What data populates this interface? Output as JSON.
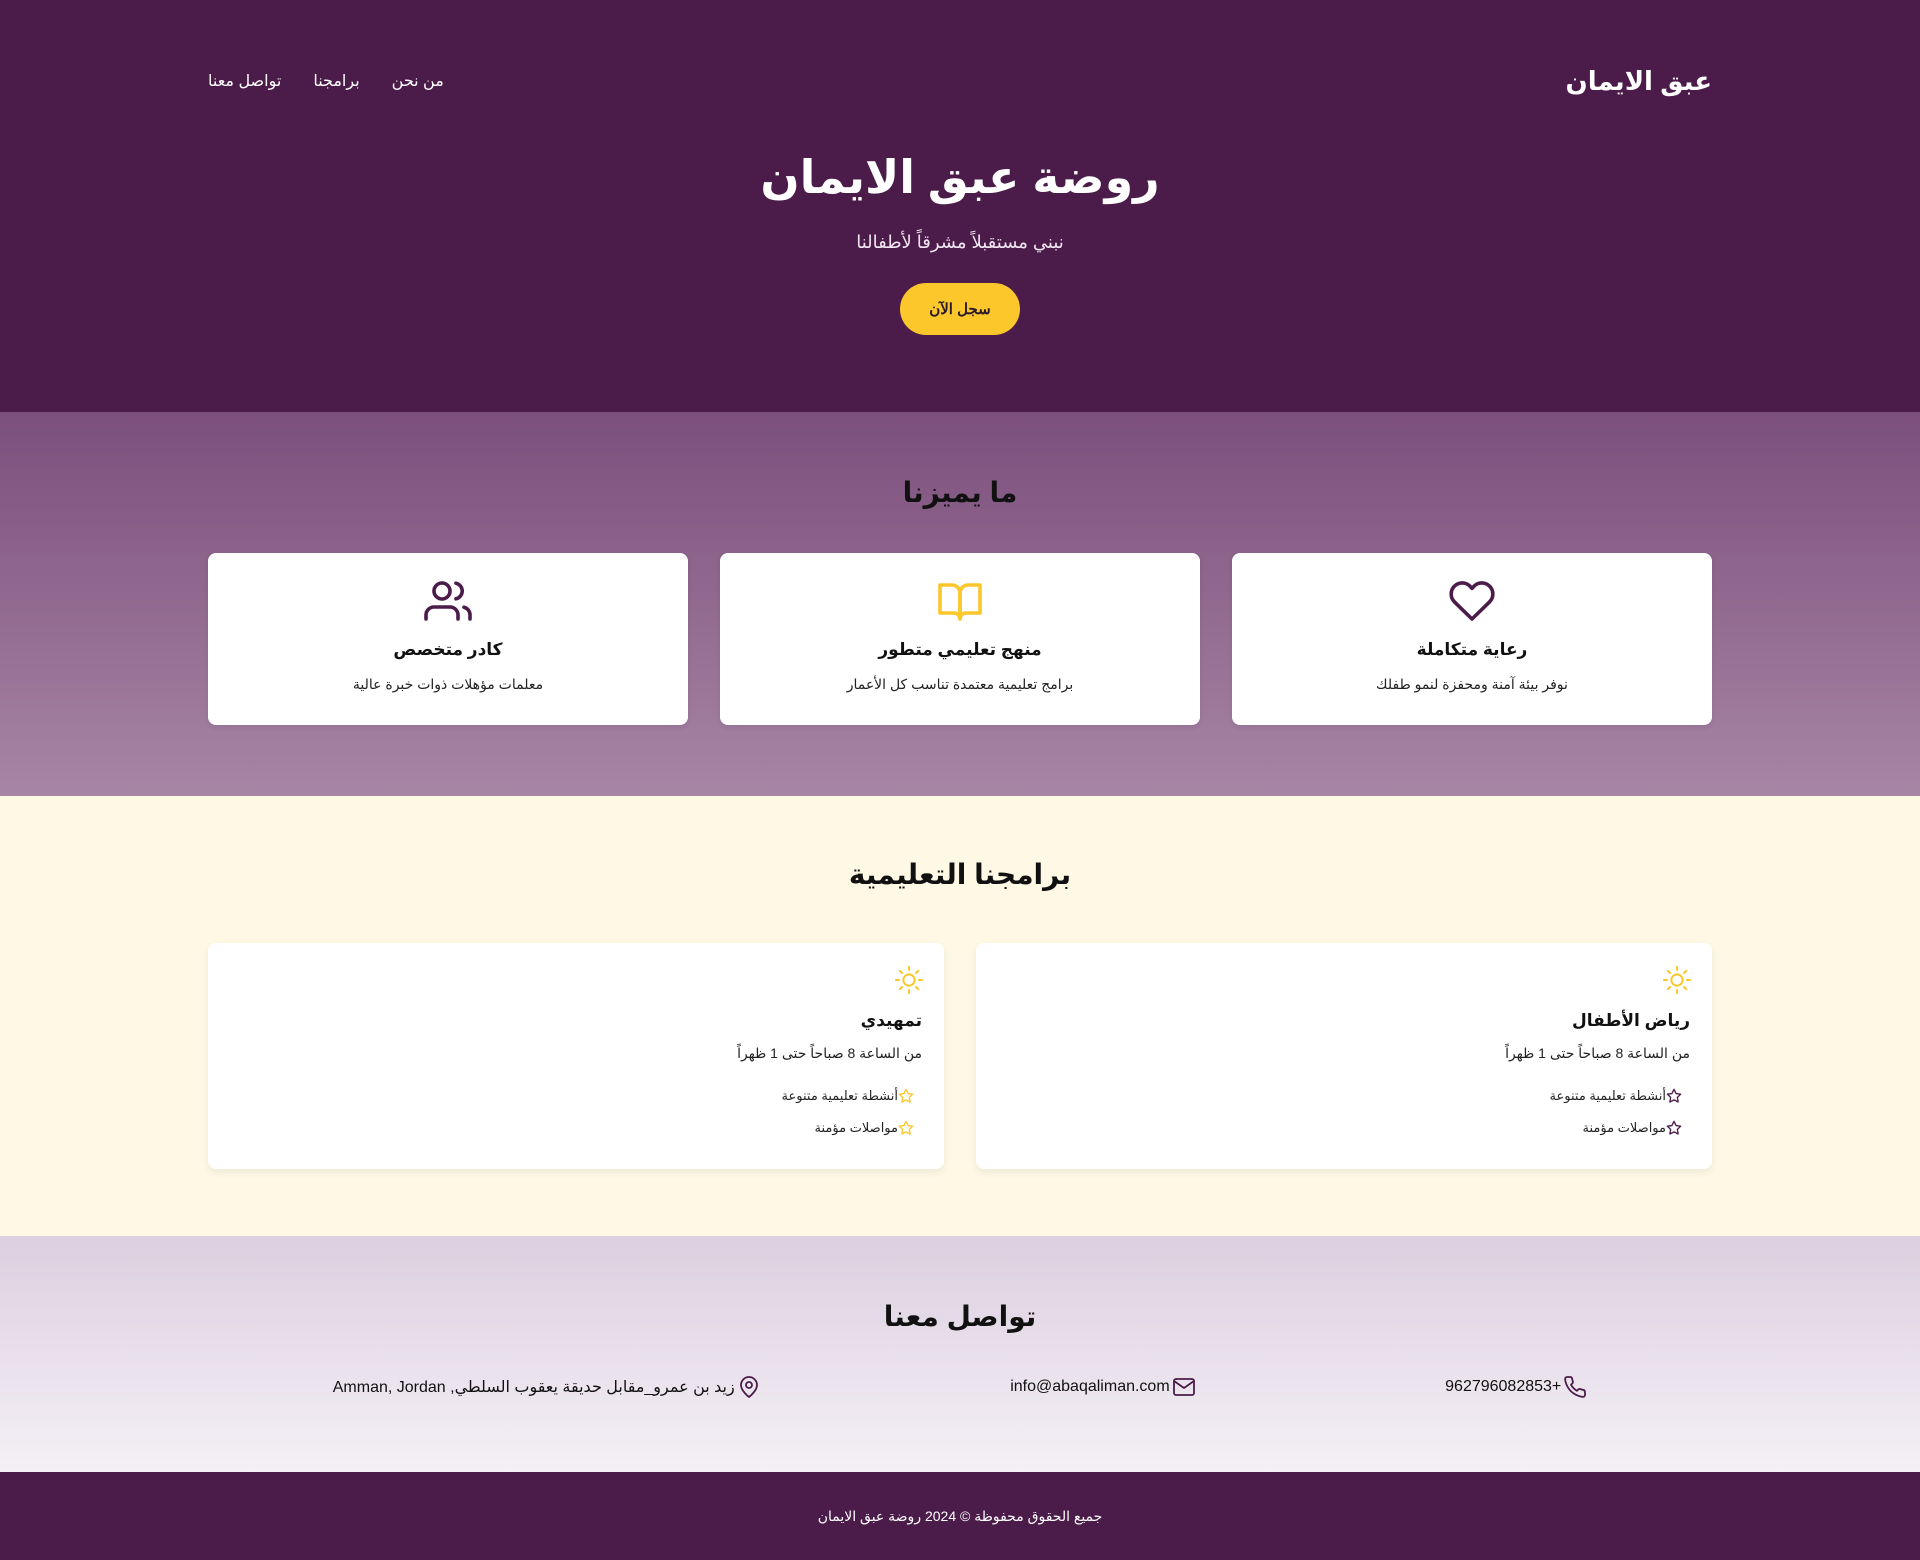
{
  "colors": {
    "primary": "#4b1c4a",
    "accent": "#fbc72a",
    "cream": "#fef8e5"
  },
  "header": {
    "logo": "عبق الايمان",
    "nav": [
      {
        "label": "من نحن"
      },
      {
        "label": "برامجنا"
      },
      {
        "label": "تواصل معنا"
      }
    ]
  },
  "hero": {
    "title": "روضة عبق الايمان",
    "subtitle": "نبني مستقبلاً مشرقاً لأطفالنا",
    "cta": "سجل الآن"
  },
  "features": {
    "title": "ما يميزنا",
    "items": [
      {
        "icon": "heart-icon",
        "title": "رعاية متكاملة",
        "text": "نوفر بيئة آمنة ومحفزة لنمو طفلك"
      },
      {
        "icon": "book-icon",
        "title": "منهج تعليمي متطور",
        "text": "برامج تعليمية معتمدة تناسب كل الأعمار"
      },
      {
        "icon": "users-icon",
        "title": "كادر متخصص",
        "text": "معلمات مؤهلات ذوات خبرة عالية"
      }
    ]
  },
  "programs": {
    "title": "برامجنا التعليمية",
    "items": [
      {
        "icon": "sun-icon",
        "title": "رياض الأطفال",
        "time": "من الساعة 8 صباحاً حتى 1 ظهراً",
        "features": [
          "أنشطة تعليمية متنوعة",
          "مواصلات مؤمنة"
        ]
      },
      {
        "icon": "sun-icon",
        "title": "تمهيدي",
        "time": "من الساعة 8 صباحاً حتى 1 ظهراً",
        "features": [
          "أنشطة تعليمية متنوعة",
          "مواصلات مؤمنة"
        ]
      }
    ]
  },
  "contact": {
    "title": "تواصل معنا",
    "phone": "962796082853+",
    "email": "info@abaqaliman.com",
    "address": "زيد بن عمرو_مقابل حديقة يعقوب السلطي, Amman, Jordan"
  },
  "footer": {
    "text": "جميع الحقوق محفوظة © 2024 روضة عبق الايمان"
  }
}
